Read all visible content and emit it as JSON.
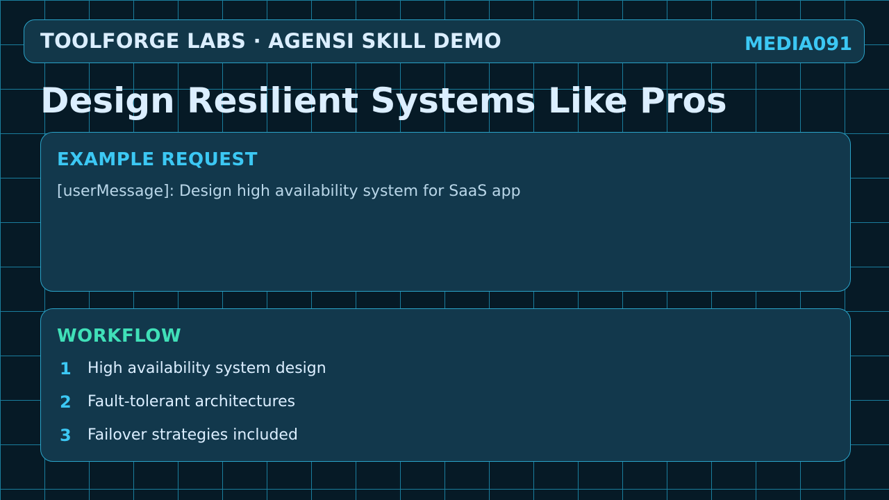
{
  "header": {
    "title": "TOOLFORGE LABS · AGENSI SKILL DEMO",
    "code": "MEDIA091"
  },
  "page": {
    "title": "Design Resilient Systems Like Pros"
  },
  "request": {
    "heading": "EXAMPLE REQUEST",
    "text": "[userMessage]: Design high availability system for SaaS app"
  },
  "workflow": {
    "heading": "WORKFLOW",
    "steps": [
      {
        "num": "1",
        "text": "High availability system design"
      },
      {
        "num": "2",
        "text": "Fault-tolerant architectures"
      },
      {
        "num": "3",
        "text": "Failover strategies included"
      }
    ]
  },
  "colors": {
    "background": "#061a26",
    "grid": "#1a7e9e",
    "panel": "#12384c",
    "accent_cyan": "#3cc8f4",
    "accent_green": "#40e0b8",
    "text_light": "#dbeeff"
  }
}
